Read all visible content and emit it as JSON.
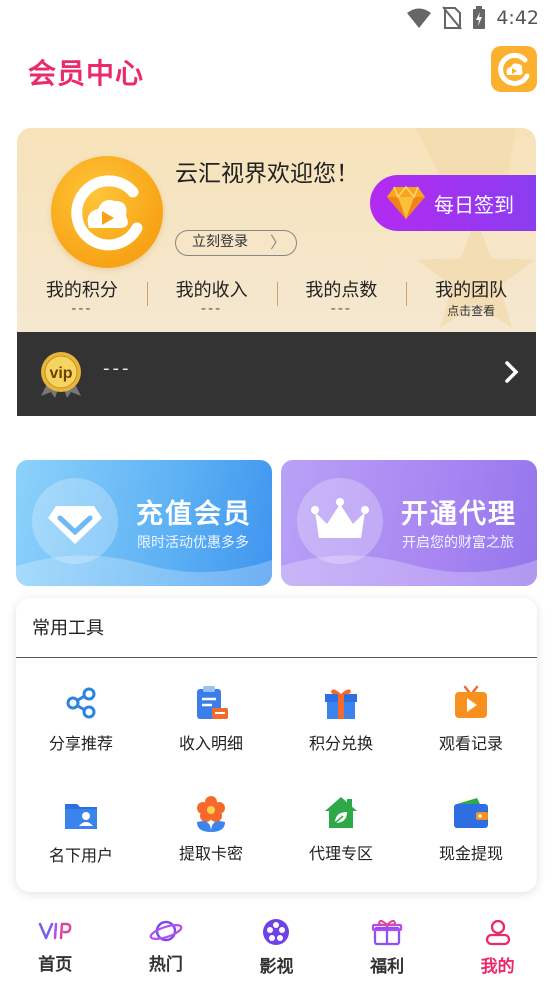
{
  "status_bar": {
    "time": "4:42"
  },
  "header": {
    "title": "会员中心"
  },
  "profile": {
    "welcome": "云汇视界欢迎您！",
    "login_label": "立刻登录",
    "checkin_label": "每日签到",
    "stats": [
      {
        "label": "我的积分",
        "value": "---"
      },
      {
        "label": "我的收入",
        "value": "---"
      },
      {
        "label": "我的点数",
        "value": "---"
      },
      {
        "label": "我的团队",
        "sub": "点击查看"
      }
    ],
    "vip": {
      "badge": "vip",
      "text": "---"
    }
  },
  "promos": [
    {
      "title": "充值会员",
      "sub": "限时活动优惠多多"
    },
    {
      "title": "开通代理",
      "sub": "开启您的财富之旅"
    }
  ],
  "tools": {
    "title": "常用工具",
    "items": [
      {
        "label": "分享推荐",
        "icon": "share-icon"
      },
      {
        "label": "收入明细",
        "icon": "clipboard-icon"
      },
      {
        "label": "积分兑换",
        "icon": "gift-icon"
      },
      {
        "label": "观看记录",
        "icon": "tv-play-icon"
      },
      {
        "label": "名下用户",
        "icon": "user-folder-icon"
      },
      {
        "label": "提取卡密",
        "icon": "flower-icon"
      },
      {
        "label": "代理专区",
        "icon": "house-leaf-icon"
      },
      {
        "label": "现金提现",
        "icon": "wallet-icon"
      }
    ]
  },
  "tabbar": {
    "active": "我的",
    "items": [
      {
        "label": "首页",
        "icon": "vip-icon"
      },
      {
        "label": "热门",
        "icon": "planet-icon"
      },
      {
        "label": "影视",
        "icon": "film-reel-icon"
      },
      {
        "label": "福利",
        "icon": "gift-icon"
      },
      {
        "label": "我的",
        "icon": "user-icon"
      }
    ]
  },
  "colors": {
    "accent": "#ea2a6d",
    "checkin": "#9a36f0",
    "recharge": "#5db1f4",
    "agent": "#a886f2",
    "vip_bar": "#333333",
    "logo": "#fbb12d"
  }
}
